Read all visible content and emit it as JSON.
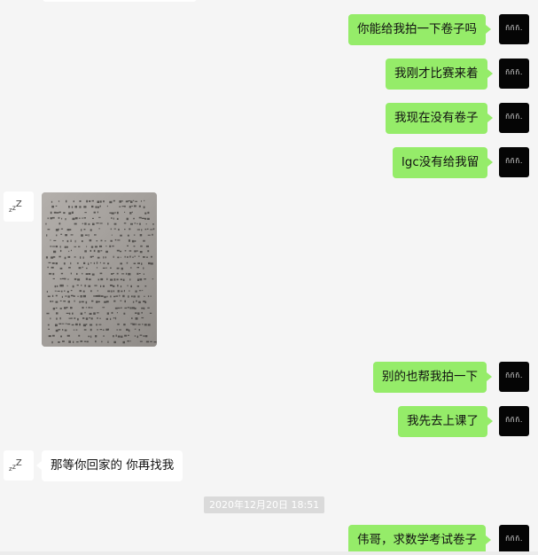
{
  "messages": {
    "m1": "你能给我拍一下卷子吗",
    "m2": "我刚才比赛来着",
    "m3": "我现在没有卷子",
    "m4": "lgc没有给我留",
    "m5": "别的也帮我拍一下",
    "m6": "我先去上课了",
    "m7": "那等你回家的 你再找我",
    "m8": "伟哥，求数学考试卷子"
  },
  "timestamp": "2020年12月20日 18:51",
  "avatars": {
    "self_text": "ñññ.",
    "self_icon": "self-avatar",
    "other_icon": "zzz-sleep-avatar"
  },
  "photo": {
    "icon": "exam-paper-photo"
  },
  "colors": {
    "background": "#f5f5f5",
    "self_bubble": "#95ec69",
    "other_bubble": "#ffffff",
    "self_avatar": "#050505",
    "timestamp_bg": "#dadada"
  }
}
